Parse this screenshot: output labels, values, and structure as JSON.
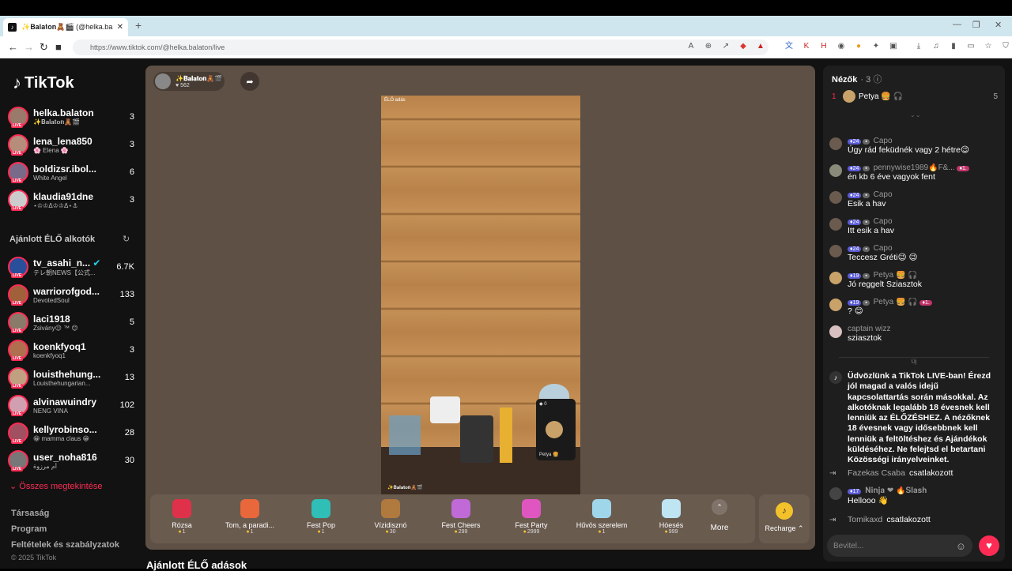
{
  "browser": {
    "tab_title": "✨𝐁𝐚𝐥𝐚𝐭𝐨𝐧🧸🎬 (@helka.ba",
    "url": "https://www.tiktok.com/@helka.balaton/live"
  },
  "logo": "TikTok",
  "following": [
    {
      "name": "helka.balaton",
      "sub": "✨𝐁𝐚𝐥𝐚𝐭𝐨𝐧🧸🎬",
      "count": "3"
    },
    {
      "name": "lena_lena850",
      "sub": "🌸 Elena 🌸",
      "count": "3"
    },
    {
      "name": "boldizsr.ibol...",
      "sub": "White Angel",
      "count": "6"
    },
    {
      "name": "klaudia91dne",
      "sub": "⋆♔♔Δ♔♔Δ⋆⚓",
      "count": "3"
    }
  ],
  "recommended_title": "Ajánlott ÉLŐ alkotók",
  "recommended": [
    {
      "name": "tv_asahi_n...",
      "sub": "テレ朝NEWS【公式...",
      "count": "6.7K",
      "verified": true
    },
    {
      "name": "warriorofgod...",
      "sub": "DevotedSoul",
      "count": "133"
    },
    {
      "name": "laci1918",
      "sub": "Zsivány😉 ™ 😊",
      "count": "5"
    },
    {
      "name": "koenkfyoq1",
      "sub": "koenkfyoq1",
      "count": "3"
    },
    {
      "name": "louisthehung...",
      "sub": "Louisthehungarian...",
      "count": "13"
    },
    {
      "name": "alvinawuindry",
      "sub": "NENG VINA",
      "count": "102"
    },
    {
      "name": "kellyrobinso...",
      "sub": "😁 mamma claus 😁",
      "count": "28"
    },
    {
      "name": "user_noha816",
      "sub": "أم مرزوة",
      "count": "30"
    }
  ],
  "see_all": "Összes megtekintése",
  "footer": [
    "Társaság",
    "Program",
    "Feltételek és szabályzatok"
  ],
  "copyright": "© 2025 TikTok",
  "host": {
    "name": "✨𝐁𝐚𝐥𝐚𝐭𝐨𝐧🧸🎬",
    "likes": "562"
  },
  "video": {
    "top_label": "ÉLŐ adás",
    "bottom_label": "✨𝐁𝐚𝐥𝐚𝐭𝐨𝐧🧸🎬",
    "pip_count": "0",
    "pip_name": "Petya 🍔"
  },
  "gifts": [
    {
      "name": "Rózsa",
      "price": "1",
      "color": "#e0314b"
    },
    {
      "name": "Tom, a paradi...",
      "price": "1",
      "color": "#e8673b"
    },
    {
      "name": "Fest Pop",
      "price": "1",
      "color": "#2fbfb6"
    },
    {
      "name": "Vízidisznó",
      "price": "30",
      "color": "#b07a3e"
    },
    {
      "name": "Fest Cheers",
      "price": "299",
      "color": "#c06ad8"
    },
    {
      "name": "Fest Party",
      "price": "2999",
      "color": "#e056c0"
    },
    {
      "name": "Hűvös szerelem",
      "price": "1",
      "color": "#9fd6ea"
    },
    {
      "name": "Hóesés",
      "price": "999",
      "color": "#bfe4f2"
    }
  ],
  "more_label": "More",
  "recharge_label": "Recharge",
  "bottom_title": "Ajánlott ÉLŐ adások",
  "chat": {
    "viewers_title": "Nézők",
    "viewers_count": "3",
    "top_viewer": {
      "rank": "1",
      "name": "Petya 🍔 🎧",
      "score": "5"
    },
    "messages": [
      {
        "level": "24",
        "user": "Capo",
        "text": "Úgy rád feküdnék vagy 2 hétre😉"
      },
      {
        "level": "24",
        "user": "pennywise1989🔥F&...",
        "text": "én kb 6 éve vagyok fent"
      },
      {
        "level": "24",
        "user": "Capo",
        "text": "Esik a hav"
      },
      {
        "level": "24",
        "user": "Capo",
        "text": "Itt esik a hav"
      },
      {
        "level": "24",
        "user": "Capo",
        "text": "Teccesz Gréti😉 😉"
      },
      {
        "level": "19",
        "user": "Petya 🍔 🎧",
        "text": "Jó reggelt Sziasztok"
      },
      {
        "level": "19",
        "user": "Petya 🍔 🎧",
        "text": "? 😊"
      },
      {
        "level": "",
        "user": "captain wizz",
        "text": "sziasztok"
      }
    ],
    "new_divider": "Új",
    "system_message": "Üdvözlünk a TikTok LIVE-ban! Érezd jól magad a valós idejű kapcsolattartás során másokkal. Az alkotóknak legalább 18 évesnek kell lenniük az ÉLŐZÉSHEZ. A nézőknek 18 évesnek vagy idősebbnek kell lenniük a feltöltéshez és Ajándékok küldéséhez. Ne felejtsd el betartani Közösségi irányelveinket.",
    "joined1": {
      "user": "Fazekas Csaba",
      "action": "csatlakozott"
    },
    "msg_ninja": {
      "level": "17",
      "user": "𝐍𝐢𝐧𝐣𝐚 ❤ 🔥𝐒𝐥𝐚𝐬𝐡",
      "text": "Hellooo 👋"
    },
    "joined2": {
      "user": "Tomikaxd",
      "action": "csatlakozott"
    },
    "input_placeholder": "Bevitel..."
  }
}
